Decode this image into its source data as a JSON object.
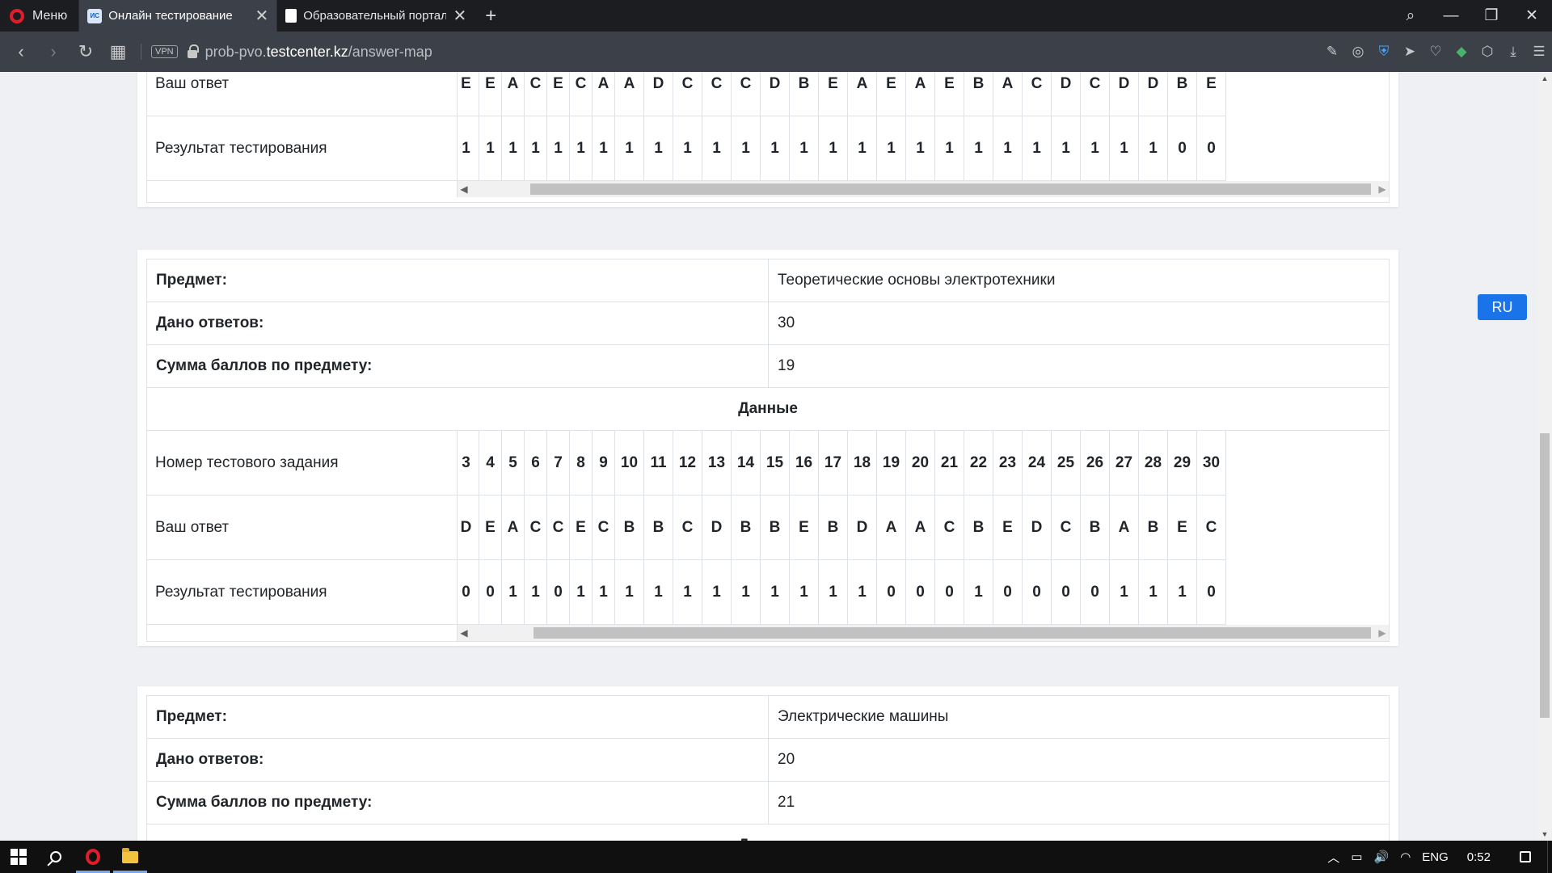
{
  "browser": {
    "menu_label": "Меню",
    "tabs": [
      {
        "favicon": "ИС",
        "title": "Онлайн тестирование",
        "active": true
      },
      {
        "favicon": "",
        "title": "Образовательный портал",
        "active": false
      }
    ],
    "url_prefix": "prob-pvo.",
    "url_host": "testcenter.kz",
    "url_path": "/answer-map",
    "vpn_label": "VPN"
  },
  "icons": {
    "search": "⌕",
    "minimize": "—",
    "restore": "❐",
    "close": "✕",
    "back": "‹",
    "forward": "›",
    "reload": "↻",
    "speed_dial": "▦",
    "new_tab": "+",
    "tab_close": "✕"
  },
  "extensions": [
    "✎",
    "◎",
    "⛨",
    "➤",
    "♡",
    "◆",
    "⬡",
    "⤓",
    "☰"
  ],
  "labels": {
    "subject": "Предмет:",
    "answers_given": "Дано ответов:",
    "score_sum": "Сумма баллов по предмету:",
    "data_heading": "Данные",
    "task_number": "Номер тестового задания",
    "your_answer": "Ваш ответ",
    "test_result": "Результат тестирования"
  },
  "partial_top": {
    "answers": [
      "E",
      "E",
      "A",
      "C",
      "E",
      "C",
      "A",
      "A",
      "D",
      "C",
      "C",
      "C",
      "D",
      "B",
      "E",
      "A",
      "E",
      "A",
      "E",
      "B",
      "A",
      "C",
      "D",
      "C",
      "D",
      "D",
      "B",
      "E"
    ],
    "results": [
      "1",
      "1",
      "1",
      "1",
      "1",
      "1",
      "1",
      "1",
      "1",
      "1",
      "1",
      "1",
      "1",
      "1",
      "1",
      "1",
      "1",
      "1",
      "1",
      "1",
      "1",
      "1",
      "1",
      "1",
      "1",
      "1",
      "0",
      "0"
    ]
  },
  "subject_toe": {
    "name": "Теоретические основы электротехники",
    "answers_given": "30",
    "score": "19",
    "numbers": [
      "3",
      "4",
      "5",
      "6",
      "7",
      "8",
      "9",
      "10",
      "11",
      "12",
      "13",
      "14",
      "15",
      "16",
      "17",
      "18",
      "19",
      "20",
      "21",
      "22",
      "23",
      "24",
      "25",
      "26",
      "27",
      "28",
      "29",
      "30"
    ],
    "answers": [
      "D",
      "E",
      "A",
      "C",
      "C",
      "E",
      "C",
      "B",
      "B",
      "C",
      "D",
      "B",
      "B",
      "E",
      "B",
      "D",
      "A",
      "A",
      "C",
      "B",
      "E",
      "D",
      "C",
      "B",
      "A",
      "B",
      "E",
      "C"
    ],
    "results": [
      "0",
      "0",
      "1",
      "1",
      "0",
      "1",
      "1",
      "1",
      "1",
      "1",
      "1",
      "1",
      "1",
      "1",
      "1",
      "1",
      "0",
      "0",
      "0",
      "1",
      "0",
      "0",
      "0",
      "0",
      "1",
      "1",
      "1",
      "0"
    ]
  },
  "subject_em": {
    "name": "Электрические машины",
    "answers_given": "20",
    "score": "21"
  },
  "language_button": "RU",
  "taskbar": {
    "tray_icons": [
      "︿",
      "▭",
      "🔊",
      "◠"
    ],
    "language": "ENG",
    "time": "0:52"
  },
  "colors": {
    "accent": "#1a73e8",
    "opera_red": "#e11d2a",
    "chrome_dark": "#1c1d21",
    "chrome": "#3c4049"
  }
}
